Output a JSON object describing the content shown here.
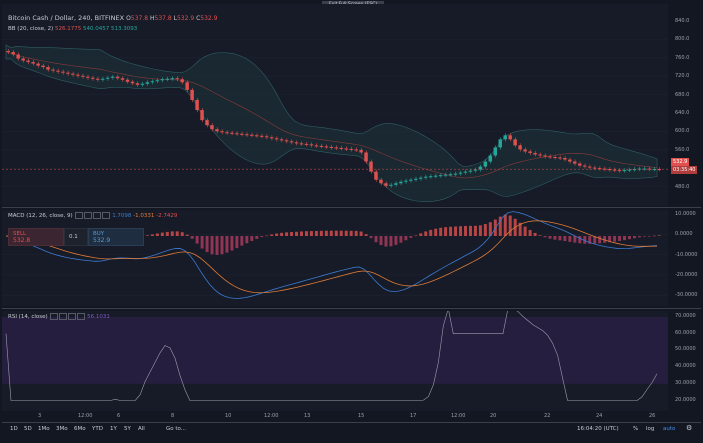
{
  "fullscreen_hint": "Exit Full Screen (ESC)",
  "legend": {
    "symbol": "Bitcoin Cash / Dollar, 240, BITFINEX",
    "o_label": "O",
    "o_value": "537.8",
    "h_label": "H",
    "h_value": "537.8",
    "l_label": "L",
    "l_value": "532.9",
    "c_label": "C",
    "c_value": "532.9"
  },
  "bb": {
    "label": "BB (20, close, 2)",
    "v1": "526.1775",
    "v2": "540.0457",
    "v3": "513.3093"
  },
  "macd": {
    "label": "MACD (12, 26, close, 9)",
    "v1": "1.7098",
    "v2": "-1.0331",
    "v3": "-2.7429"
  },
  "rsi": {
    "label": "RSI (14, close)",
    "v1": "56.1031"
  },
  "trade": {
    "sell_label": "SELL",
    "sell_price": "532.8",
    "qty": "0.1",
    "buy_label": "BUY",
    "buy_price": "532.9"
  },
  "price_axis": [
    "840.0",
    "800.0",
    "760.0",
    "720.0",
    "680.0",
    "640.0",
    "600.0",
    "560.0",
    "520.0",
    "480.0"
  ],
  "price_badge": "532.9",
  "price_badge2": "03:35:40",
  "macd_axis": [
    "10.0000",
    "0.0000",
    "-10.0000",
    "-20.0000",
    "-30.0000"
  ],
  "rsi_axis": [
    "70.0000",
    "60.0000",
    "50.0000",
    "40.0000",
    "30.0000",
    "20.0000"
  ],
  "x_axis": [
    "3",
    "12:00",
    "6",
    "8",
    "10",
    "12:00",
    "13",
    "15",
    "17",
    "12:00",
    "20",
    "22",
    "24",
    "26"
  ],
  "bottom": {
    "ranges": [
      "1D",
      "5D",
      "1Mo",
      "3Mo",
      "6Mo",
      "YTD",
      "1Y",
      "5Y",
      "All"
    ],
    "goto": "Go to...",
    "time": "16:04:20 (UTC)",
    "pct": "%",
    "log": "log",
    "auto": "auto"
  },
  "colors": {
    "up": "#26a69a",
    "down": "#e0504f",
    "bb_fill": "#1f3a3d",
    "macd": "#3b7ad1",
    "signal": "#e07b36",
    "rsi_band": "#2a1f46"
  },
  "chart_data": {
    "type": "candlestick",
    "title": "Bitcoin Cash / Dollar, 240, BITFINEX",
    "ylim": [
      460,
      860
    ],
    "closes": [
      765,
      760,
      752,
      748,
      745,
      742,
      738,
      735,
      730,
      728,
      726,
      724,
      722,
      720,
      718,
      716,
      714,
      712,
      710,
      712,
      714,
      716,
      713,
      710,
      706,
      703,
      700,
      702,
      705,
      707,
      709,
      711,
      712,
      713,
      711,
      705,
      690,
      670,
      650,
      630,
      620,
      612,
      608,
      606,
      605,
      604,
      603,
      602,
      601,
      600,
      599,
      598,
      596,
      594,
      592,
      590,
      588,
      586,
      584,
      583,
      582,
      580,
      579,
      578,
      577,
      576,
      575,
      574,
      573,
      572,
      571,
      566,
      548,
      528,
      512,
      505,
      500,
      502,
      505,
      508,
      510,
      512,
      514,
      516,
      518,
      519,
      520,
      521,
      522,
      523,
      524,
      526,
      528,
      530,
      532,
      538,
      548,
      560,
      576,
      592,
      600,
      592,
      580,
      572,
      568,
      565,
      562,
      560,
      558,
      557,
      556,
      555,
      552,
      548,
      544,
      540,
      538,
      536,
      535,
      534,
      533,
      532,
      531,
      530,
      531,
      532,
      533,
      534,
      534,
      533,
      533,
      532.9
    ]
  }
}
